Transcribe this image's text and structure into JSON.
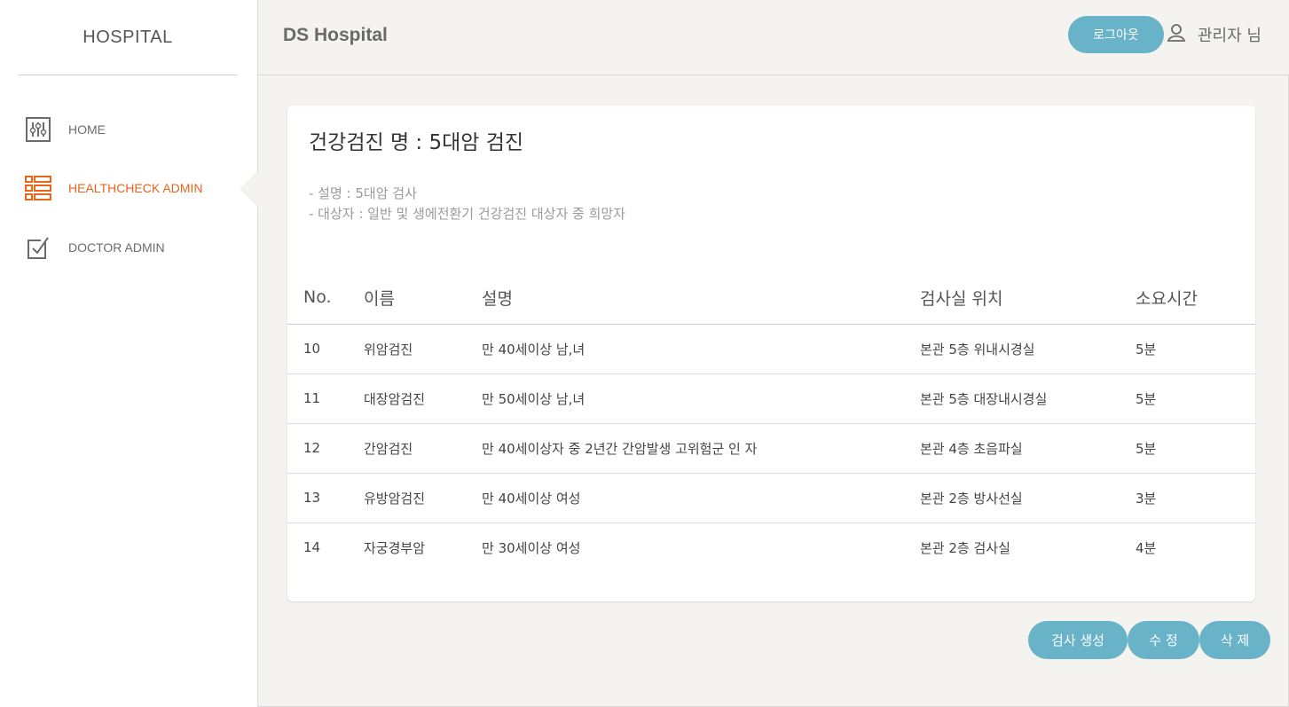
{
  "sidebar": {
    "logo": "HOSPITAL",
    "items": [
      {
        "label": "HOME",
        "icon": "sliders-icon",
        "active": false
      },
      {
        "label": "HEALTHCHECK ADMIN",
        "icon": "list-icon",
        "active": true
      },
      {
        "label": "DOCTOR ADMIN",
        "icon": "checkbox-icon",
        "active": false
      }
    ]
  },
  "header": {
    "brand": "DS Hospital",
    "logout_label": "로그아웃",
    "user_label": "관리자 님"
  },
  "card": {
    "title": "건강검진 명 : 5대암 검진",
    "desc_line1": "- 설명 : 5대암 검사",
    "desc_line2": "- 대상자 : 일반 및 생에전환기 건강검진 대상자 중 희망자"
  },
  "table": {
    "headers": [
      "No.",
      "이름",
      "설명",
      "검사실 위치",
      "소요시간"
    ],
    "rows": [
      [
        "10",
        "위암검진",
        "만 40세이상 남,녀",
        "본관 5층 위내시경실",
        "5분"
      ],
      [
        "11",
        "대장암검진",
        "만 50세이상 남,녀",
        "본관 5층 대장내시경실",
        "5분"
      ],
      [
        "12",
        "간암검진",
        "만 40세이상자 중 2년간 간암발생 고위험군 인 자",
        "본관 4층 초음파실",
        "5분"
      ],
      [
        "13",
        "유방암검진",
        "만 40세이상 여성",
        "본관 2층 방사선실",
        "3분"
      ],
      [
        "14",
        "자궁경부암",
        "만 30세이상 여성",
        "본관 2층 검사실",
        "4분"
      ]
    ]
  },
  "buttons": {
    "create": "검사 생성",
    "edit": "수 정",
    "delete": "삭 제"
  },
  "colors": {
    "accent": "#68b3c8",
    "active": "#e8651a",
    "background": "#f4f3ef"
  }
}
